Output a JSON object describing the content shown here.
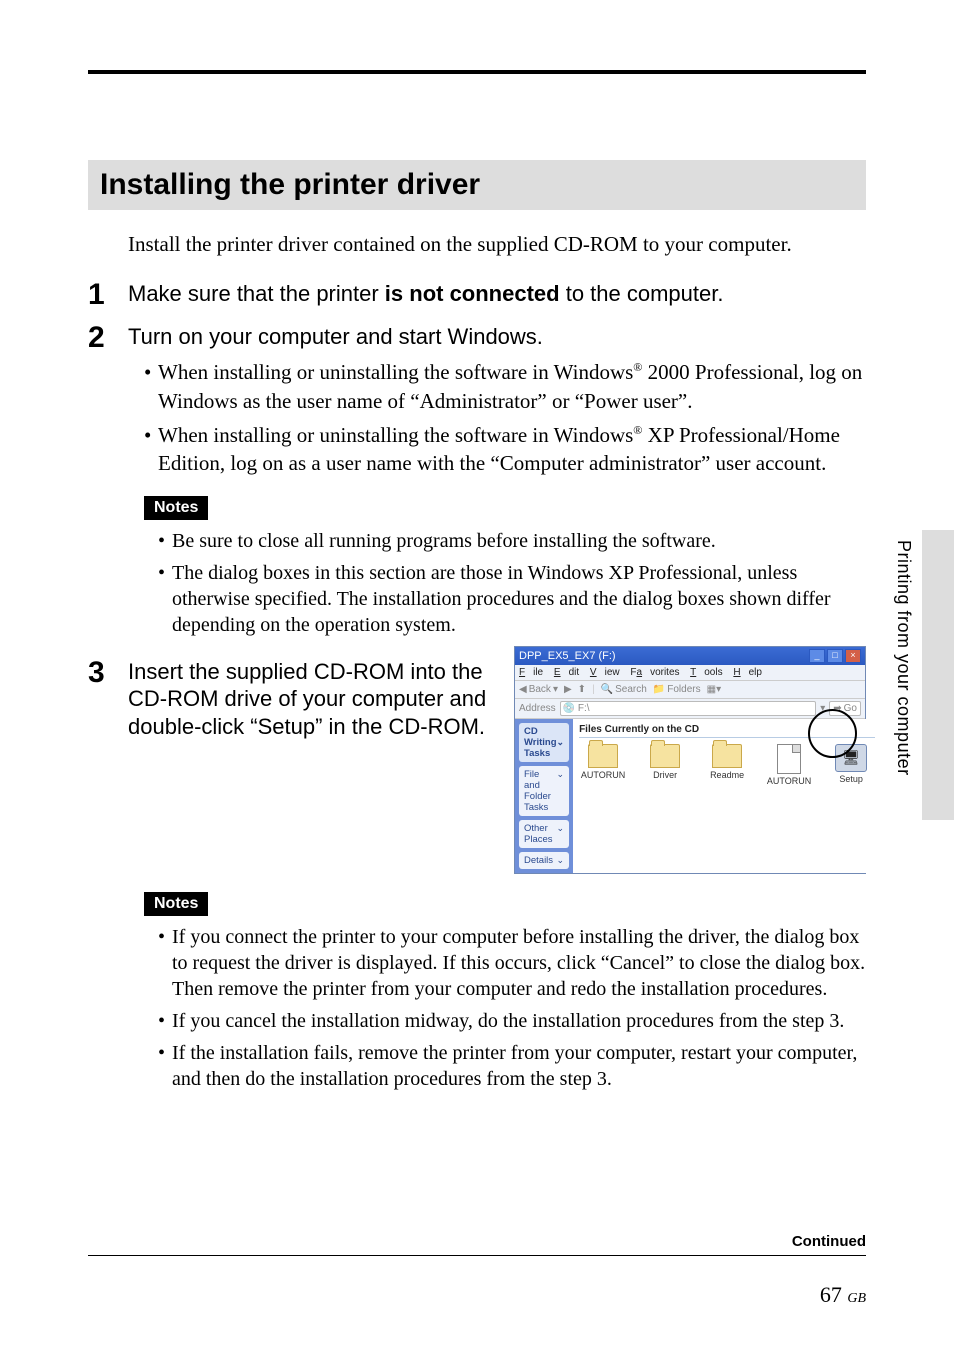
{
  "page": {
    "section_title": "Installing the printer driver",
    "intro": "Install the printer driver contained on the supplied CD-ROM to your computer.",
    "side_tab": "Printing from your computer",
    "continued": "Continued",
    "page_number": "67",
    "page_region": "GB"
  },
  "steps": {
    "s1": {
      "num": "1",
      "pre": "Make sure that the printer ",
      "bold": "is not connected",
      "post": " to the computer."
    },
    "s2": {
      "num": "2",
      "title": "Turn on your computer and start Windows.",
      "b1a": "When installing or uninstalling the software in Windows",
      "b1b": " 2000 Professional, log on Windows as the user name of “Administrator” or “Power user”.",
      "b2a": "When installing or uninstalling the software in Windows",
      "b2b": " XP Professional/Home Edition, log on as a user name with the “Computer administrator” user account."
    },
    "s3": {
      "num": "3",
      "title": "Insert the supplied CD-ROM into the CD-ROM drive of your computer and double-click “Setup” in the CD-ROM."
    }
  },
  "notes": {
    "label": "Notes",
    "n1": "Be sure to close all running programs before installing the software.",
    "n2": "The dialog boxes in this section are those in Windows XP Professional, unless otherwise specified.  The installation procedures and the dialog boxes shown differ depending on the operation system.",
    "n3": "If you connect the printer to your computer before installing the driver, the dialog box to request the driver is displayed.  If this occurs, click “Cancel” to close the dialog box.  Then remove the printer from your computer and redo the installation procedures.",
    "n4": "If you cancel the installation midway, do the installation procedures from the step 3.",
    "n5": "If the installation fails, remove the printer from your computer, restart your computer, and then do the installation procedures from the step 3."
  },
  "screenshot": {
    "title": "DPP_EX5_EX7 (F:)",
    "menu": {
      "file": "File",
      "edit": "Edit",
      "view": "View",
      "favorites": "Favorites",
      "tools": "Tools",
      "help": "Help"
    },
    "toolbar": {
      "back": "Back",
      "search": "Search",
      "folders": "Folders"
    },
    "address_label": "Address",
    "address_value": "F:\\",
    "go": "Go",
    "side": {
      "cd": "CD Writing Tasks",
      "ff": "File and Folder Tasks",
      "other": "Other Places",
      "details": "Details"
    },
    "group_header": "Files Currently on the CD",
    "icons": {
      "autorun1": "AUTORUN",
      "driver": "Driver",
      "readme": "Readme",
      "autorun2": "AUTORUN",
      "setup": "Setup"
    }
  }
}
